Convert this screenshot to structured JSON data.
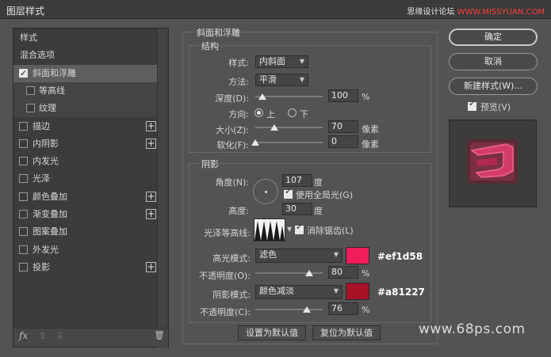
{
  "window": {
    "title": "图层样式"
  },
  "watermark_top": {
    "prefix": "思缘设计论坛 ",
    "site": "WWW.MISSYUAN.COM"
  },
  "styles_list": [
    {
      "label": "样式",
      "checkbox": false,
      "checked": false,
      "plus": false,
      "selected": false,
      "indent": false
    },
    {
      "label": "混合选项",
      "checkbox": false,
      "checked": false,
      "plus": false,
      "selected": false,
      "indent": false
    },
    {
      "label": "斜面和浮雕",
      "checkbox": true,
      "checked": true,
      "plus": false,
      "selected": true,
      "indent": false
    },
    {
      "label": "等高线",
      "checkbox": true,
      "checked": false,
      "plus": false,
      "selected": false,
      "indent": true
    },
    {
      "label": "纹理",
      "checkbox": true,
      "checked": false,
      "plus": false,
      "selected": false,
      "indent": true
    },
    {
      "label": "描边",
      "checkbox": true,
      "checked": false,
      "plus": true,
      "selected": false,
      "indent": false
    },
    {
      "label": "内阴影",
      "checkbox": true,
      "checked": false,
      "plus": true,
      "selected": false,
      "indent": false
    },
    {
      "label": "内发光",
      "checkbox": true,
      "checked": false,
      "plus": false,
      "selected": false,
      "indent": false
    },
    {
      "label": "光泽",
      "checkbox": true,
      "checked": false,
      "plus": false,
      "selected": false,
      "indent": false
    },
    {
      "label": "颜色叠加",
      "checkbox": true,
      "checked": false,
      "plus": true,
      "selected": false,
      "indent": false
    },
    {
      "label": "渐变叠加",
      "checkbox": true,
      "checked": false,
      "plus": true,
      "selected": false,
      "indent": false
    },
    {
      "label": "图案叠加",
      "checkbox": true,
      "checked": false,
      "plus": false,
      "selected": false,
      "indent": false
    },
    {
      "label": "外发光",
      "checkbox": true,
      "checked": false,
      "plus": false,
      "selected": false,
      "indent": false
    },
    {
      "label": "投影",
      "checkbox": true,
      "checked": false,
      "plus": true,
      "selected": false,
      "indent": false
    }
  ],
  "left_toolbar": {
    "fx": "fx",
    "up": "⇧",
    "down": "⇩",
    "trash": "🗑"
  },
  "bevel": {
    "group_title": "斜面和浮雕",
    "structure": {
      "title": "结构",
      "style_label": "样式:",
      "style_value": "内斜面",
      "technique_label": "方法:",
      "technique_value": "平滑",
      "depth_label": "深度(D):",
      "depth_value": "100",
      "depth_unit": "%",
      "depth_level": 0.1,
      "direction_label": "方向:",
      "direction_up": "上",
      "direction_down": "下",
      "size_label": "大小(Z):",
      "size_value": "70",
      "size_unit": "像素",
      "size_level": 0.28,
      "soften_label": "软化(F):",
      "soften_value": "0",
      "soften_unit": "像素",
      "soften_level": 0.0
    },
    "shading": {
      "title": "阴影",
      "angle_label": "角度(N):",
      "angle_value": "107",
      "angle_unit": "度",
      "global_light_label": "使用全局光(G)",
      "altitude_label": "高度:",
      "altitude_value": "30",
      "altitude_unit": "度",
      "gloss_label": "光泽等高线:",
      "antialias_label": "消除锯齿(L)",
      "highlight_mode_label": "高光模式:",
      "highlight_mode_value": "滤色",
      "highlight_color": "#ef1d58",
      "highlight_hex": "#ef1d58",
      "highlight_opacity_label": "不透明度(O):",
      "highlight_opacity_value": "80",
      "highlight_opacity_unit": "%",
      "highlight_opacity_level": 0.8,
      "shadow_mode_label": "阴影模式:",
      "shadow_mode_value": "颜色减淡",
      "shadow_color": "#a81227",
      "shadow_hex": "#a81227",
      "shadow_opacity_label": "不透明度(C):",
      "shadow_opacity_value": "76",
      "shadow_opacity_unit": "%",
      "shadow_opacity_level": 0.76
    },
    "make_default": "设置为默认值",
    "reset_default": "复位为默认值"
  },
  "buttons": {
    "ok": "确定",
    "cancel": "取消",
    "new_style": "新建样式(W)...",
    "preview_label": "预览(V)"
  },
  "watermark_bottom": "www.68ps.com"
}
